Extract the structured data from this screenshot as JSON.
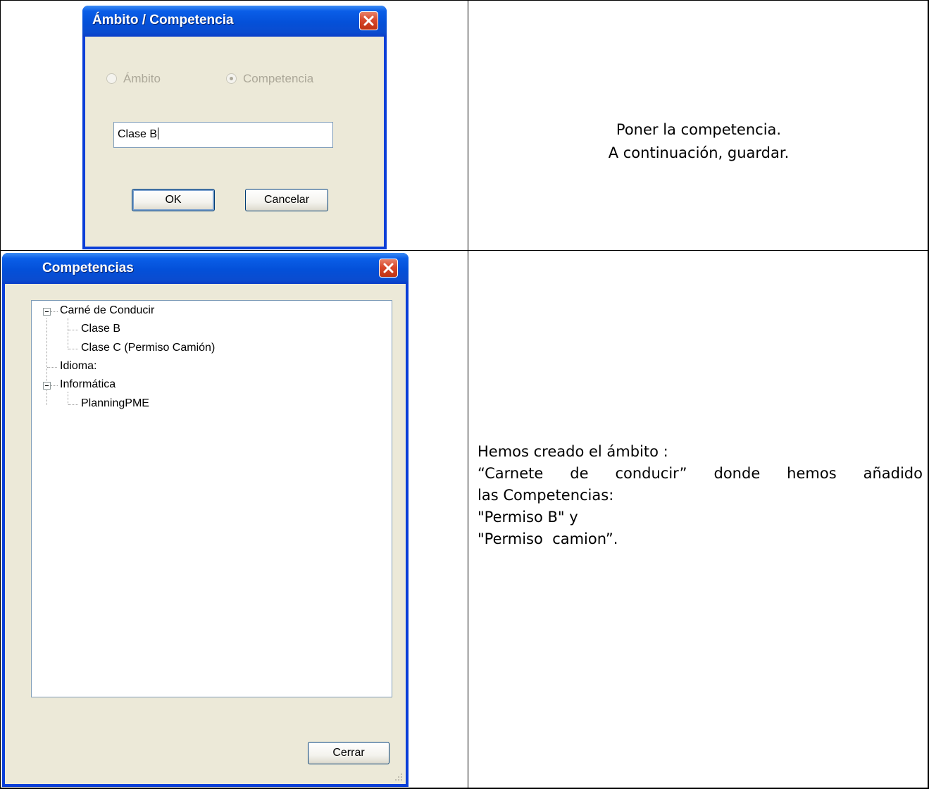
{
  "dialog_ambito": {
    "title": "Ámbito / Competencia",
    "radio_ambito_label": "Ámbito",
    "radio_competencia_label": "Competencia",
    "input_value": "Clase B",
    "ok_label": "OK",
    "cancel_label": "Cancelar"
  },
  "dialog_competencias": {
    "title": "Competencias",
    "tree": [
      {
        "label": "Carné de Conducir",
        "expanded": true,
        "children": [
          "Clase B",
          "Clase C (Permiso Camión)"
        ]
      },
      {
        "label": "Idioma:",
        "expanded": false,
        "children": []
      },
      {
        "label": "Informática",
        "expanded": true,
        "children": [
          "PlanningPME"
        ]
      }
    ],
    "close_label": "Cerrar"
  },
  "instructions": {
    "top_line1": "Poner la competencia.",
    "top_line2": "A continuación, guardar.",
    "bottom_line1": "Hemos creado el ámbito :",
    "bottom_line2": "“Carnete de conducir” donde hemos añadido",
    "bottom_line3": "las Competencias:",
    "bottom_line4": "\"Permiso B\" y",
    "bottom_line5": "\"Permiso  camion”."
  },
  "colors": {
    "titlebar": "#0450d8",
    "dialog_face": "#ece9d8",
    "close_button": "#d8482c",
    "input_border": "#7f9db9"
  }
}
